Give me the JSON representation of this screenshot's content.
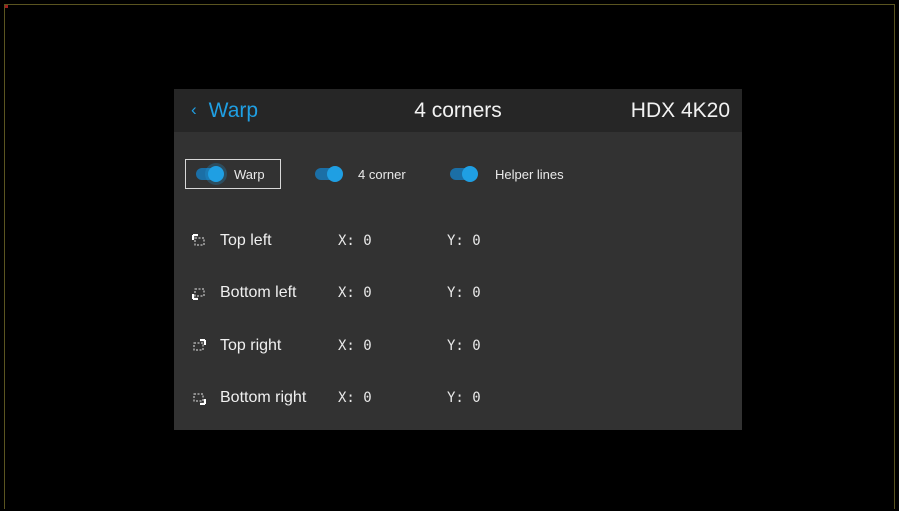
{
  "header": {
    "back_label": "Warp",
    "title": "4 corners",
    "device": "HDX 4K20"
  },
  "toggles": [
    {
      "label": "Warp",
      "on": true,
      "focused": true
    },
    {
      "label": "4 corner",
      "on": true,
      "focused": false
    },
    {
      "label": "Helper lines",
      "on": true,
      "focused": false
    }
  ],
  "corners": [
    {
      "name": "Top left",
      "icon": "top-left-corner-icon",
      "x_label": "X:",
      "x": "0",
      "y_label": "Y:",
      "y": "0"
    },
    {
      "name": "Bottom left",
      "icon": "bottom-left-corner-icon",
      "x_label": "X:",
      "x": "0",
      "y_label": "Y:",
      "y": "0"
    },
    {
      "name": "Top right",
      "icon": "top-right-corner-icon",
      "x_label": "X:",
      "x": "0",
      "y_label": "Y:",
      "y": "0"
    },
    {
      "name": "Bottom right",
      "icon": "bottom-right-corner-icon",
      "x_label": "X:",
      "x": "0",
      "y_label": "Y:",
      "y": "0"
    }
  ],
  "colors": {
    "accent": "#1f9fe3",
    "panel": "#323232",
    "header": "#262626",
    "background": "#000000"
  }
}
